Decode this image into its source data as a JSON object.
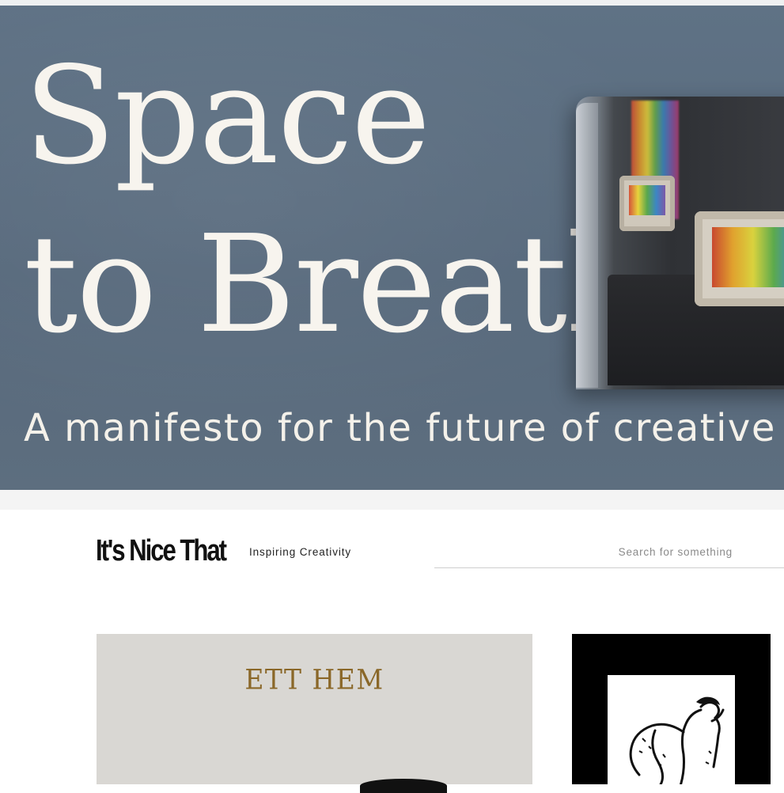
{
  "banner": {
    "headline_line1": "Space",
    "headline_line2": "to Breathe",
    "subheadline": "A manifesto for the future of creative wo",
    "colors": {
      "background": "#5b6d80",
      "text": "#f7f4ee"
    }
  },
  "header": {
    "logo": "It's Nice That",
    "tagline": "Inspiring Creativity",
    "search_placeholder": "Search for something"
  },
  "articles": [
    {
      "image_text": "ETT HEM",
      "colors": {
        "background": "#d9d7d3",
        "text": "#8a6728"
      }
    },
    {
      "image_icon": "figure-drawing",
      "colors": {
        "background": "#000000"
      }
    }
  ]
}
